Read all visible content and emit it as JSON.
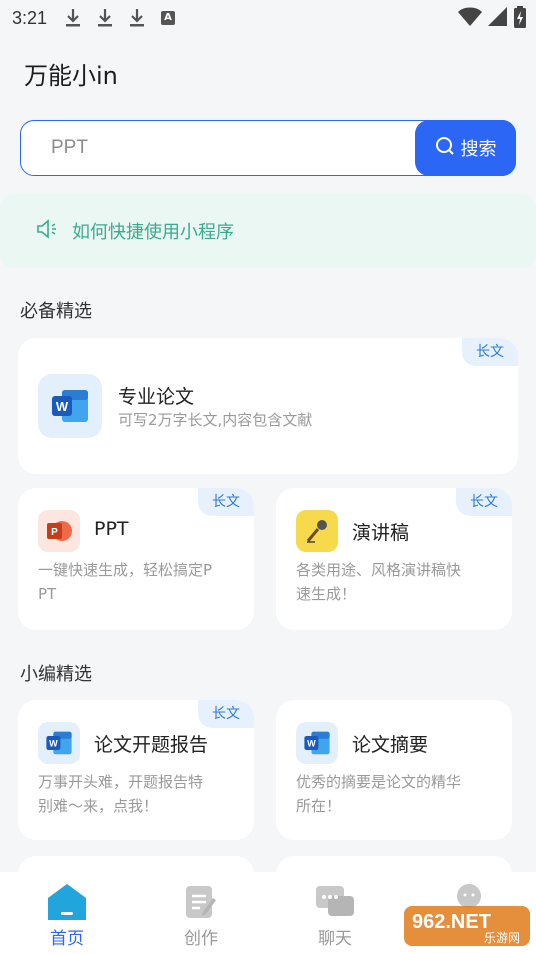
{
  "status_bar": {
    "time": "3:21",
    "icons": [
      "download-icon",
      "download-icon",
      "download-icon",
      "a-notification-icon",
      "wifi-icon",
      "signal-icon",
      "battery-charging-icon"
    ]
  },
  "app": {
    "title": "万能小in"
  },
  "search": {
    "placeholder": "PPT",
    "button_label": "搜索"
  },
  "tip": {
    "text": "如何快捷使用小程序",
    "icon": "speaker-icon"
  },
  "sections": {
    "essential": {
      "title": "必备精选"
    },
    "editor": {
      "title": "小编精选"
    }
  },
  "cards": {
    "thesis": {
      "title": "专业论文",
      "desc": "可写2万字长文,内容包含文献",
      "badge": "长文",
      "icon": "word-icon"
    },
    "ppt": {
      "title": "PPT",
      "desc_line1": "一键快速生成，轻松搞定P",
      "desc_line2": "PT",
      "badge": "长文",
      "icon": "powerpoint-icon"
    },
    "speech": {
      "title": "演讲稿",
      "desc_line1": "各类用途、风格演讲稿快",
      "desc_line2": "速生成！",
      "badge": "长文",
      "icon": "microphone-icon"
    },
    "proposal": {
      "title": "论文开题报告",
      "desc_line1": "万事开头难，开题报告特",
      "desc_line2": "别难～来，点我！",
      "badge": "长文",
      "icon": "word-icon"
    },
    "abstract": {
      "title": "论文摘要",
      "desc_line1": "优秀的摘要是论文的精华",
      "desc_line2": "所在！",
      "icon": "word-icon"
    }
  },
  "tabs": [
    {
      "label": "首页",
      "icon": "home-icon",
      "active": true
    },
    {
      "label": "创作",
      "icon": "edit-document-icon",
      "active": false
    },
    {
      "label": "聊天",
      "icon": "chat-icon",
      "active": false
    },
    {
      "label": "",
      "icon": "profile-icon",
      "active": false
    }
  ],
  "watermark": {
    "text": "962.NET",
    "subtext": "乐游网"
  },
  "colors": {
    "accent": "#2c66f5",
    "tip_green": "#3bab8e",
    "badge_blue": "#2a7ad8"
  }
}
